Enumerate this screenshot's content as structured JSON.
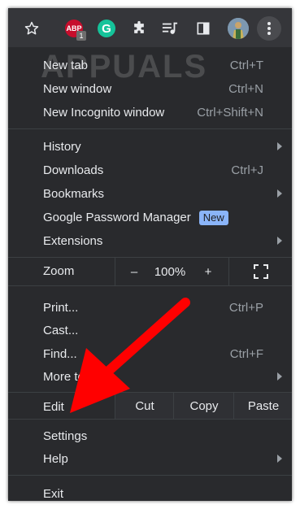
{
  "toolbar": {
    "abp_label": "ABP",
    "abp_badge": "1",
    "grammarly_label": "G"
  },
  "watermark": "APPUALS",
  "menu": {
    "new_tab": {
      "label": "New tab",
      "shortcut": "Ctrl+T"
    },
    "new_window": {
      "label": "New window",
      "shortcut": "Ctrl+N"
    },
    "new_incognito": {
      "label": "New Incognito window",
      "shortcut": "Ctrl+Shift+N"
    },
    "history": {
      "label": "History"
    },
    "downloads": {
      "label": "Downloads",
      "shortcut": "Ctrl+J"
    },
    "bookmarks": {
      "label": "Bookmarks"
    },
    "password_manager": {
      "label": "Google Password Manager",
      "badge": "New"
    },
    "extensions": {
      "label": "Extensions"
    },
    "zoom": {
      "label": "Zoom",
      "minus": "–",
      "value": "100%",
      "plus": "+"
    },
    "print": {
      "label": "Print...",
      "shortcut": "Ctrl+P"
    },
    "cast": {
      "label": "Cast..."
    },
    "find": {
      "label": "Find...",
      "shortcut": "Ctrl+F"
    },
    "more_tools": {
      "label": "More tools"
    },
    "edit": {
      "label": "Edit",
      "cut": "Cut",
      "copy": "Copy",
      "paste": "Paste"
    },
    "settings": {
      "label": "Settings"
    },
    "help": {
      "label": "Help"
    },
    "exit": {
      "label": "Exit"
    }
  },
  "colors": {
    "menu_bg": "#292a2d",
    "text": "#e8eaed",
    "shortcut": "#9aa0a6",
    "new_badge": "#8ab4f8",
    "annotation_arrow": "#ff0000"
  }
}
